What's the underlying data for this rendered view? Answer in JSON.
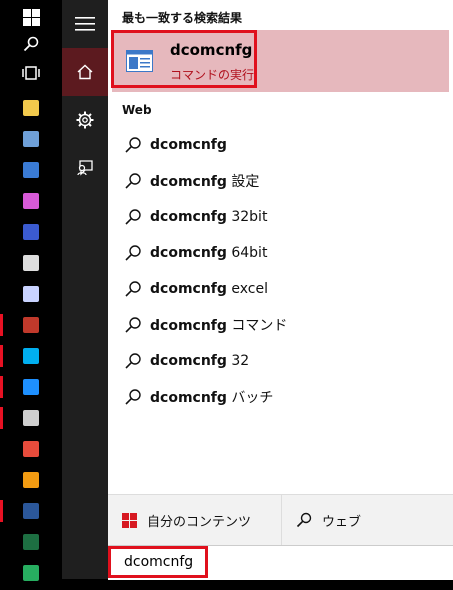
{
  "taskbar": {
    "start_icon": "windows-logo-icon",
    "search_icon": "search-icon",
    "taskview_icon": "task-view-icon",
    "apps": [
      {
        "name": "file-explorer-icon",
        "color": "#f2c94c",
        "running": false
      },
      {
        "name": "server-manager-icon",
        "color": "#6fa0d8",
        "running": false
      },
      {
        "name": "contact-card-icon",
        "color": "#3a7bd5",
        "running": false
      },
      {
        "name": "itunes-icon",
        "color": "#d85ad8",
        "running": false
      },
      {
        "name": "eye-app-icon",
        "color": "#3b5bd0",
        "running": false
      },
      {
        "name": "tool-app-icon",
        "color": "#dddddd",
        "running": false
      },
      {
        "name": "disc-app-icon",
        "color": "#c9d3ff",
        "running": false
      },
      {
        "name": "game-app-icon",
        "color": "#c0392b",
        "running": true
      },
      {
        "name": "skype-icon",
        "color": "#00aff0",
        "running": true
      },
      {
        "name": "internet-explorer-icon",
        "color": "#1e90ff",
        "running": true
      },
      {
        "name": "j-app-icon",
        "color": "#cfcfcf",
        "running": true
      },
      {
        "name": "pinwheel-app-icon",
        "color": "#e74c3c",
        "running": false
      },
      {
        "name": "media-player-icon",
        "color": "#f39c12",
        "running": false
      },
      {
        "name": "word-icon",
        "color": "#2b579a",
        "running": true
      },
      {
        "name": "excel-icon",
        "color": "#1d6f42",
        "running": false
      },
      {
        "name": "green-app-icon",
        "color": "#27ae60",
        "running": false
      }
    ]
  },
  "rail": {
    "menu_icon": "hamburger-menu-icon",
    "home_icon": "home-icon",
    "settings_icon": "gear-icon",
    "feedback_icon": "feedback-icon"
  },
  "results": {
    "best_match_header": "最も一致する検索結果",
    "best_match": {
      "name": "dcomcnfg",
      "subtitle": "コマンドの実行",
      "icon": "app-window-icon"
    },
    "web_header": "Web",
    "web_items": [
      {
        "bold": "dcomcnfg",
        "rest": ""
      },
      {
        "bold": "dcomcnfg",
        "rest": " 設定"
      },
      {
        "bold": "dcomcnfg",
        "rest": " 32bit"
      },
      {
        "bold": "dcomcnfg",
        "rest": " 64bit"
      },
      {
        "bold": "dcomcnfg",
        "rest": " excel"
      },
      {
        "bold": "dcomcnfg",
        "rest": " コマンド"
      },
      {
        "bold": "dcomcnfg",
        "rest": " 32"
      },
      {
        "bold": "dcomcnfg",
        "rest": " バッチ"
      }
    ]
  },
  "bottom": {
    "my_content_label": "自分のコンテンツ",
    "web_label": "ウェブ"
  },
  "search": {
    "value": "dcomcnfg"
  },
  "colors": {
    "accent": "#e0101d",
    "highlight": "#e6b8bd",
    "rail_active": "#5c1a1f",
    "rail_bg": "#1f1f1f"
  }
}
